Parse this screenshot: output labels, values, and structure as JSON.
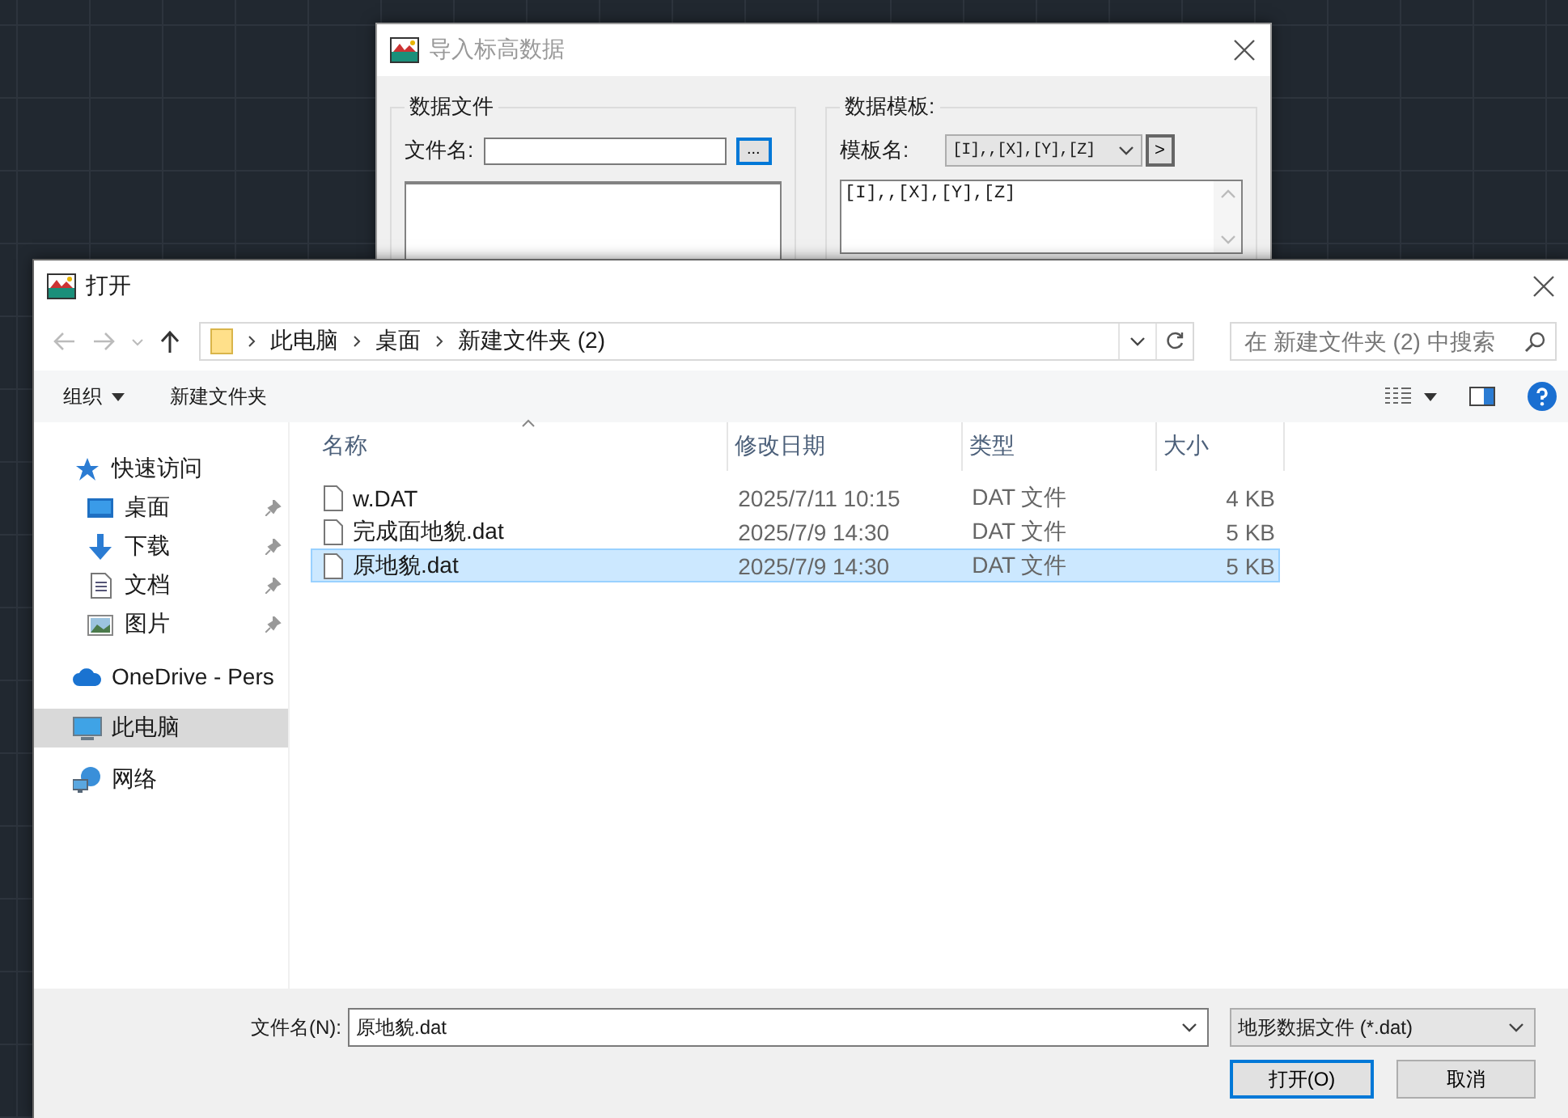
{
  "import_dialog": {
    "title": "导入标高数据",
    "data_file_group": {
      "title": "数据文件",
      "filename_label": "文件名:",
      "browse_button": "..."
    },
    "template_group": {
      "title": "数据模板:",
      "name_label": "模板名:",
      "template_select": "[I],,[X],[Y],[Z]",
      "next_button": ">",
      "template_text": "[I],,[X],[Y],[Z]"
    }
  },
  "open_dialog": {
    "title": "打开",
    "breadcrumbs": [
      "此电脑",
      "桌面",
      "新建文件夹 (2)"
    ],
    "search": {
      "placeholder": "在 新建文件夹 (2) 中搜索"
    },
    "toolbar": {
      "organize": "组织",
      "new_folder": "新建文件夹"
    },
    "nav_items": [
      {
        "label": "快速访问",
        "kind": "star",
        "selected": false,
        "pinned": false,
        "children": [
          {
            "label": "桌面",
            "kind": "desktop",
            "selected": false,
            "pinned": true
          },
          {
            "label": "下载",
            "kind": "download",
            "selected": false,
            "pinned": true
          },
          {
            "label": "文档",
            "kind": "document",
            "selected": false,
            "pinned": true
          },
          {
            "label": "图片",
            "kind": "picture",
            "selected": false,
            "pinned": true
          }
        ]
      },
      {
        "label": "OneDrive - Pers",
        "kind": "cloud",
        "selected": false,
        "pinned": false
      },
      {
        "label": "此电脑",
        "kind": "computer",
        "selected": true,
        "pinned": false
      },
      {
        "label": "网络",
        "kind": "network",
        "selected": false,
        "pinned": false
      }
    ],
    "columns": [
      {
        "label": "名称",
        "sorted": true
      },
      {
        "label": "修改日期",
        "sorted": false
      },
      {
        "label": "类型",
        "sorted": false
      },
      {
        "label": "大小",
        "sorted": false
      }
    ],
    "files": [
      {
        "name": "w.DAT",
        "modified": "2025/7/11 10:15",
        "type": "DAT 文件",
        "size": "4 KB",
        "selected": false
      },
      {
        "name": "完成面地貌.dat",
        "modified": "2025/7/9 14:30",
        "type": "DAT 文件",
        "size": "5 KB",
        "selected": false
      },
      {
        "name": "原地貌.dat",
        "modified": "2025/7/9 14:30",
        "type": "DAT 文件",
        "size": "5 KB",
        "selected": true
      }
    ],
    "filename": {
      "label": "文件名(N):",
      "value": "原地貌.dat"
    },
    "filter": "地形数据文件 (*.dat)",
    "buttons": [
      {
        "label": "打开(O)",
        "default": true
      },
      {
        "label": "取消",
        "default": false
      }
    ]
  }
}
